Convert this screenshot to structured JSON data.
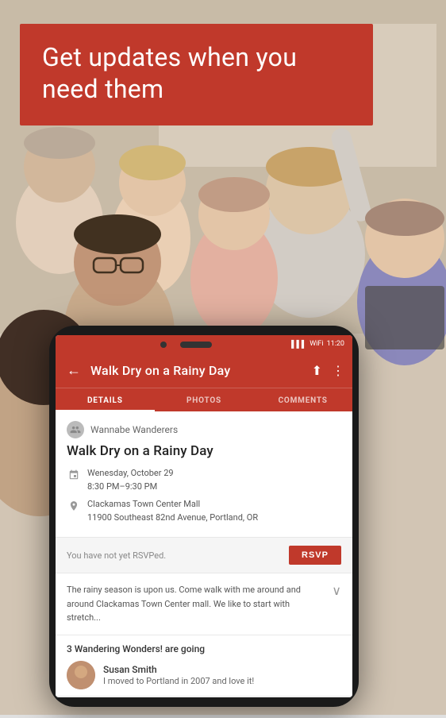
{
  "hero": {
    "title_line1": "Get updates when you",
    "title_line2": "need them"
  },
  "phone": {
    "status_bar": {
      "signal": "▌▌▌",
      "wifi": "WiFi",
      "time": "11:20"
    },
    "toolbar": {
      "back_label": "←",
      "title": "Walk Dry on a Rainy Day",
      "share_icon": "share-icon",
      "more_icon": "more-icon"
    },
    "tabs": [
      {
        "label": "DETAILS",
        "active": true
      },
      {
        "label": "PHOTOS",
        "active": false
      },
      {
        "label": "COMMENTS",
        "active": false
      }
    ],
    "group": {
      "name": "Wannabe Wanderers",
      "icon": "👥"
    },
    "event": {
      "title": "Walk Dry on a Rainy Day",
      "date": "Wenesday, October 29",
      "time": "8:30 PM–9:30 PM",
      "location_name": "Clackamas Town Center Mall",
      "location_address": "11900 Southeast 82nd Avenue, Portland, OR"
    },
    "rsvp": {
      "status_text": "You have not yet RSVPed.",
      "button_label": "RSVP"
    },
    "description": {
      "text": "The rainy season is upon us. Come walk with me around and around Clackamas Town Center mall. We like to start with stretch..."
    },
    "attendees": {
      "heading": "3 Wandering Wonders! are going",
      "list": [
        {
          "name": "Susan Smith",
          "description": "I moved to Portland in 2007 and love it!"
        }
      ]
    }
  }
}
